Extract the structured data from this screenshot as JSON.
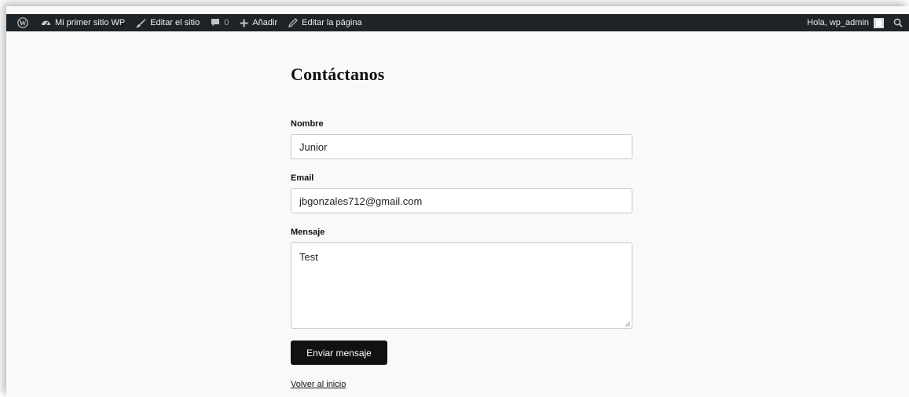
{
  "admin_bar": {
    "site_name": "Mi primer sitio WP",
    "edit_site": "Editar el sitio",
    "comments_count": "0",
    "add_new": "Añadir",
    "edit_page": "Editar la página",
    "greeting": "Hola, wp_admin",
    "icons": [
      "wordpress-logo-icon",
      "dashboard-gauge-icon",
      "brush-icon",
      "comment-icon",
      "plus-icon",
      "pencil-icon",
      "avatar",
      "search-icon"
    ]
  },
  "page": {
    "title": "Contáctanos"
  },
  "form": {
    "name_label": "Nombre",
    "name_value": "Junior",
    "email_label": "Email",
    "email_value": "jbgonzales712@gmail.com",
    "message_label": "Mensaje",
    "message_value": "Test",
    "submit_label": "Enviar mensaje"
  },
  "footer": {
    "back_link": "Volver al inicio"
  },
  "colors": {
    "admin_bar_bg": "#1d2327",
    "page_bg": "#f9f9f9",
    "button_bg": "#111111"
  }
}
